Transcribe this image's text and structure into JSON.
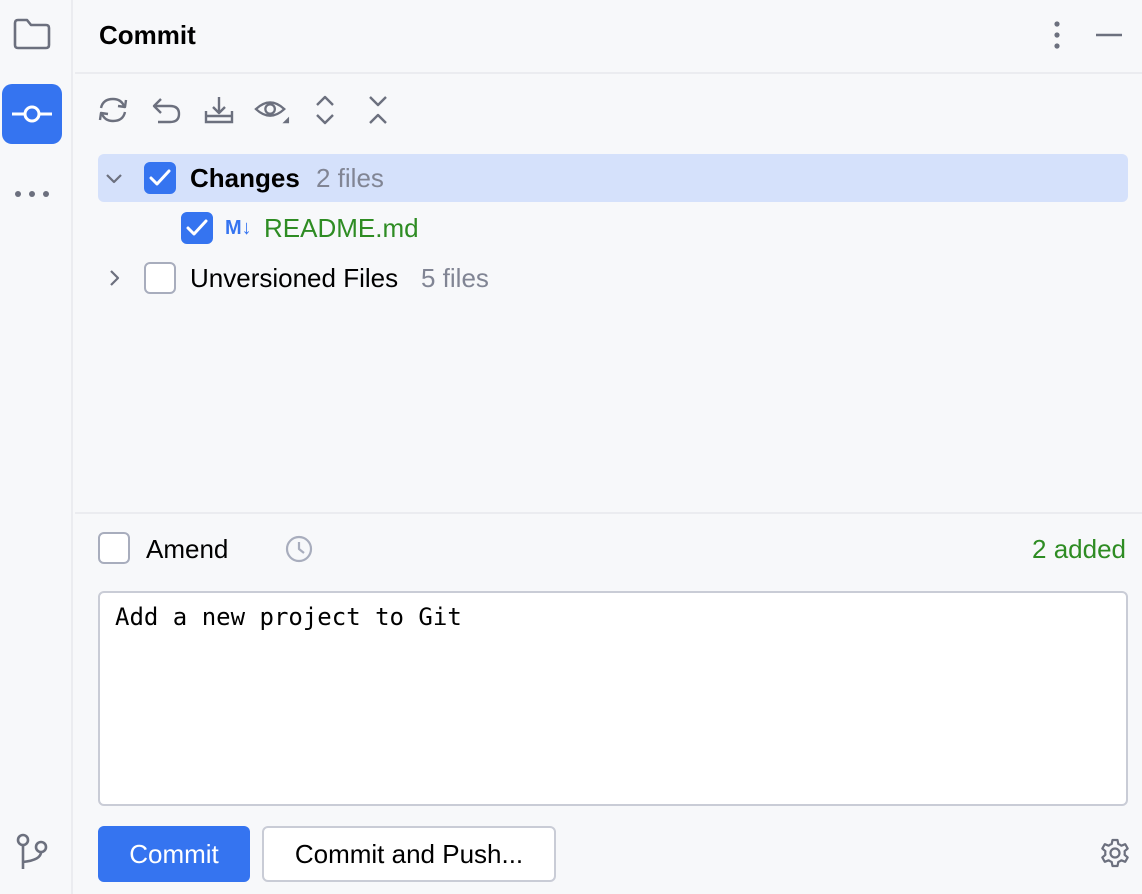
{
  "rail": {
    "items": [
      {
        "icon": "folder-icon"
      },
      {
        "icon": "commit-icon",
        "active": true
      },
      {
        "icon": "more-horizontal-icon"
      }
    ],
    "bottom_icon": "git-branch-icon"
  },
  "panel": {
    "title": "Commit",
    "actions": [
      "more-vertical-icon",
      "minimize-icon"
    ]
  },
  "toolbar": {
    "icons": [
      "refresh-icon",
      "rollback-icon",
      "update-icon",
      "preview-icon",
      "expand-all-icon",
      "collapse-all-icon"
    ]
  },
  "tree": {
    "changes": {
      "label": "Changes",
      "count": "2 files",
      "checked": true,
      "expanded": true
    },
    "changes_files": [
      {
        "badge": "M↓",
        "name": "README.md",
        "checked": true,
        "status_color": "#2e8c23"
      }
    ],
    "unversioned": {
      "label": "Unversioned Files",
      "count": "5 files",
      "checked": false,
      "expanded": false
    }
  },
  "amend": {
    "label": "Amend",
    "checked": false
  },
  "summary": {
    "added": "2 added"
  },
  "message": {
    "value": "Add a new project to Git"
  },
  "buttons": {
    "commit": "Commit",
    "commit_and_push": "Commit and Push..."
  },
  "colors": {
    "accent": "#3574f0",
    "added_green": "#2e8c23",
    "selection": "#d5e1fb"
  }
}
